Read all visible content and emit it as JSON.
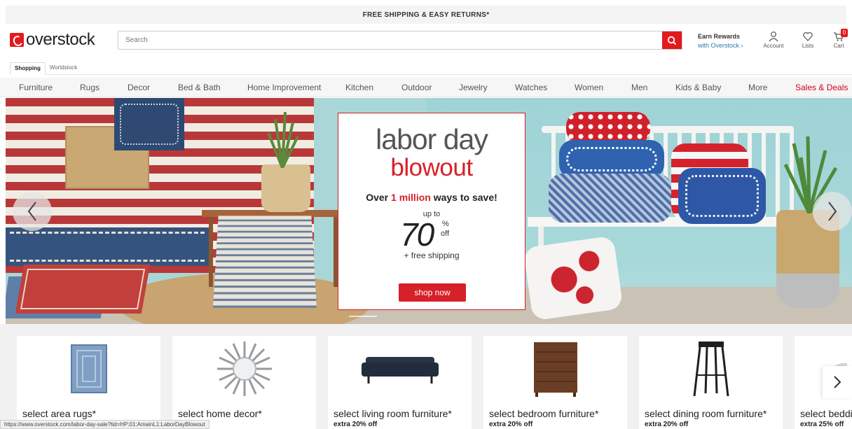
{
  "promo_bar": {
    "text": "FREE SHIPPING & EASY RETURNS*"
  },
  "header": {
    "logo_text": "overstock",
    "search_placeholder": "Search",
    "rewards_line1": "Earn Rewards",
    "rewards_line2": "with Overstock ›",
    "account_label": "Account",
    "lists_label": "Lists",
    "cart_label": "Cart",
    "cart_count": "0"
  },
  "tabs": [
    {
      "label": "Shopping",
      "active": true
    },
    {
      "label": "Worldstock",
      "active": false
    }
  ],
  "categories": [
    "Furniture",
    "Rugs",
    "Decor",
    "Bed & Bath",
    "Home Improvement",
    "Kitchen",
    "Outdoor",
    "Jewelry",
    "Watches",
    "Women",
    "Men",
    "Kids & Baby",
    "More",
    "Sales & Deals"
  ],
  "hero": {
    "line1": "labor day",
    "line2": "blowout",
    "ways_prefix": "Over ",
    "ways_highlight": "1 million",
    "ways_suffix": " ways to save!",
    "up_to": "up to",
    "percent_number": "70",
    "percent_sign": "%",
    "off_text": "off",
    "free_shipping": "+ free shipping",
    "button_label": "shop now"
  },
  "tiles": [
    {
      "title": "select area rugs*",
      "subtitle": "",
      "icon": "rug-icon"
    },
    {
      "title": "select home decor*",
      "subtitle": "",
      "icon": "mirror-icon"
    },
    {
      "title": "select living room furniture*",
      "subtitle": "extra 20% off",
      "icon": "sofa-icon"
    },
    {
      "title": "select bedroom furniture*",
      "subtitle": "extra 20% off",
      "icon": "dresser-icon"
    },
    {
      "title": "select dining room furniture*",
      "subtitle": "extra 20% off",
      "icon": "stool-icon"
    },
    {
      "title": "select beddi",
      "subtitle": "extra 25% off",
      "icon": "bedding-icon"
    }
  ],
  "status_url": "https://www.overstock.com/labor-day-sale?tid=HP:01:AmainL1:LaborDayBlowout",
  "colors": {
    "brand_red": "#e3191b",
    "accent_red": "#d6202a",
    "link_blue": "#2a7ab0"
  }
}
